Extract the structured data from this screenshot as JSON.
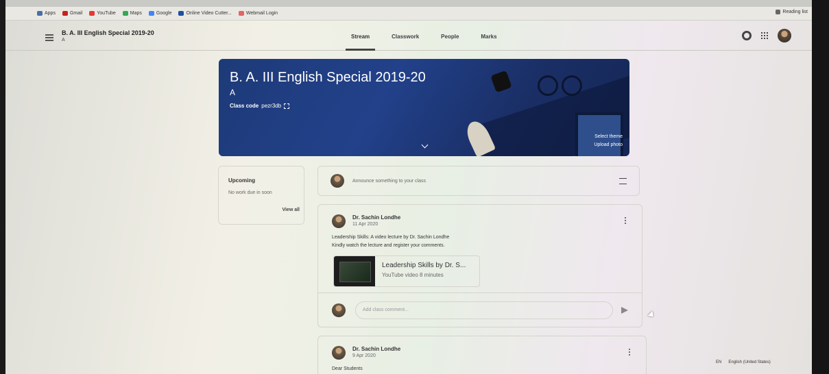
{
  "bookmarks": [
    {
      "label": "Apps",
      "color": "#4a6fa5"
    },
    {
      "label": "Gmail",
      "color": "#c5221f"
    },
    {
      "label": "YouTube",
      "color": "#e53935"
    },
    {
      "label": "Maps",
      "color": "#34a853"
    },
    {
      "label": "Google",
      "color": "#4285f4"
    },
    {
      "label": "Online Video Cutter...",
      "color": "#1e4fa0"
    },
    {
      "label": "Webmail Login",
      "color": "#e06666"
    }
  ],
  "reading_list": "Reading list",
  "header": {
    "class_title": "B. A. III English Special 2019-20",
    "class_section": "A",
    "tabs": [
      "Stream",
      "Classwork",
      "People",
      "Marks"
    ]
  },
  "banner": {
    "title": "B. A. III English Special 2019-20",
    "section": "A",
    "class_code_label": "Class code",
    "class_code": "pezr3db",
    "select_theme": "Select theme",
    "upload_photo": "Upload photo"
  },
  "upcoming": {
    "heading": "Upcoming",
    "text": "No work due in soon",
    "view_all": "View all"
  },
  "announce_placeholder": "Announce something to your class",
  "posts": [
    {
      "author": "Dr. Sachin Londhe",
      "date": "11 Apr 2020",
      "line1": "Leadership Skills: A video lecture by Dr. Sachin Londhe",
      "line2": "Kindly watch the lecture and register your comments.",
      "attachment_title": "Leadership Skills by Dr. S...",
      "attachment_sub": "YouTube video   8 minutes",
      "comment_placeholder": "Add class comment..."
    },
    {
      "author": "Dr. Sachin Londhe",
      "date": "9 Apr 2020",
      "line1": "Dear Students"
    }
  ],
  "language": {
    "code": "EN",
    "name": "English (United States)"
  }
}
